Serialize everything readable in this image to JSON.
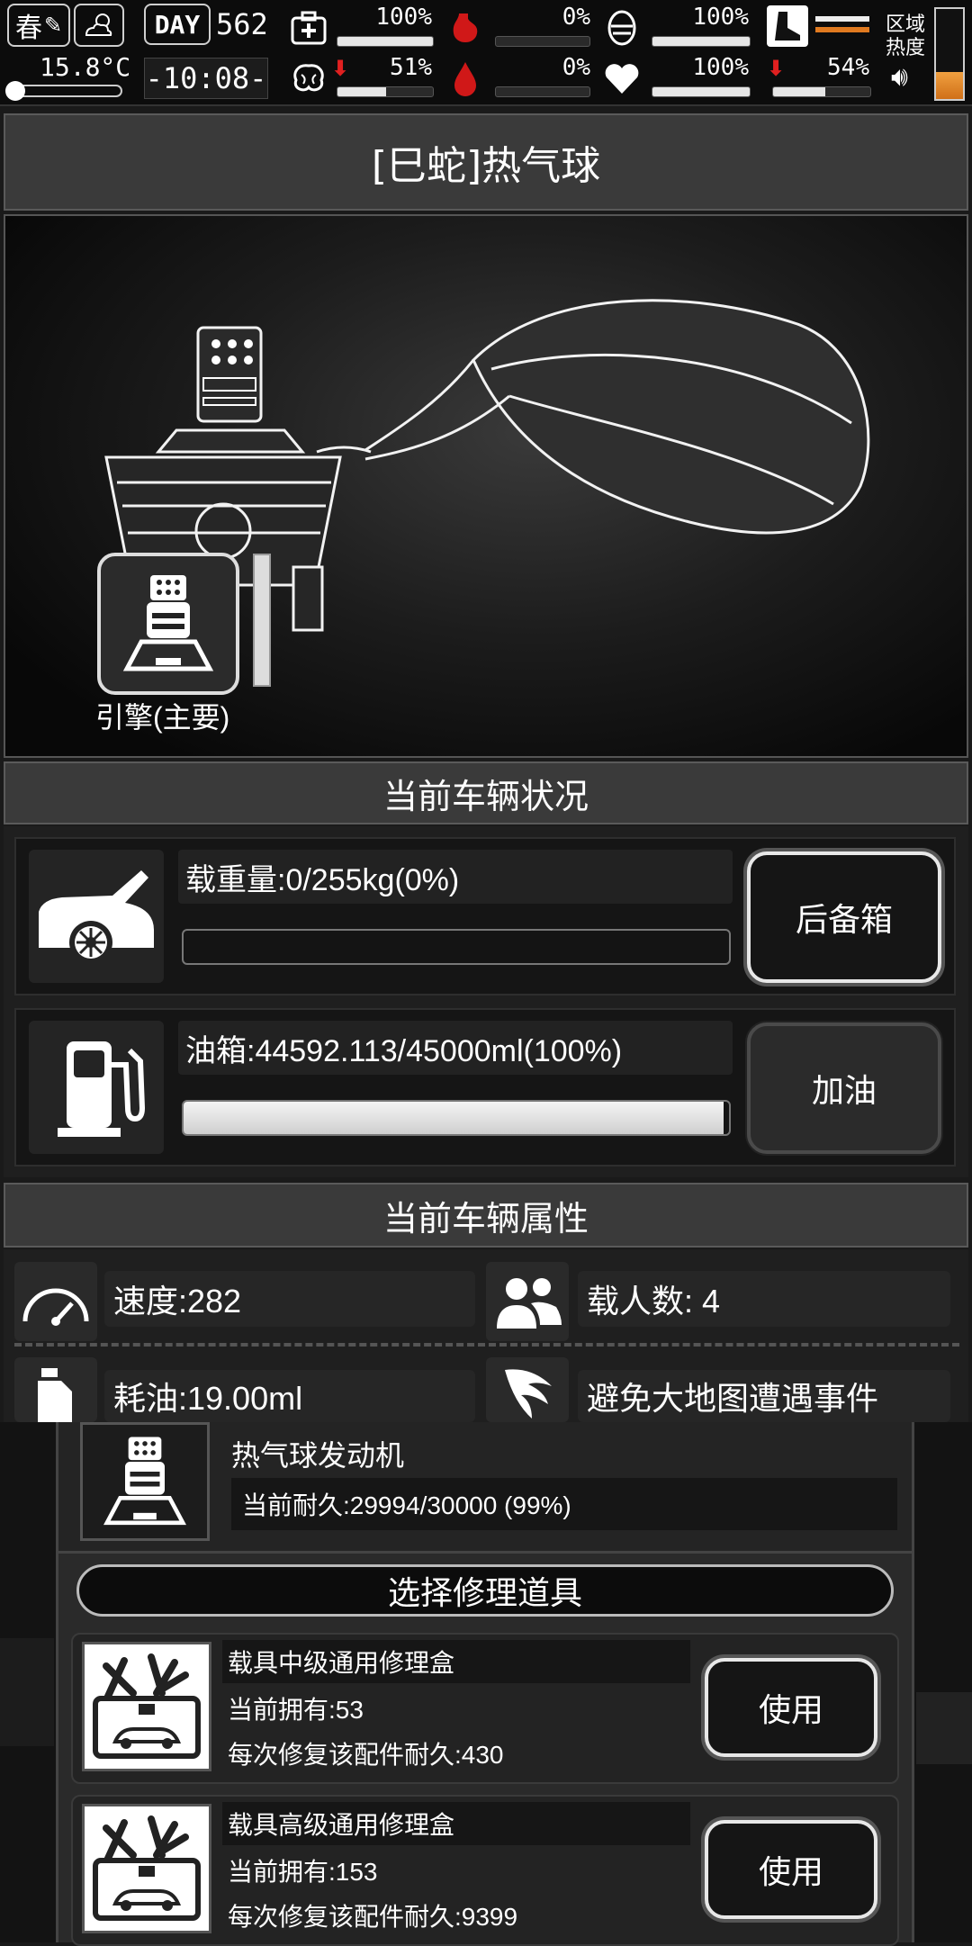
{
  "topbar": {
    "season": "春",
    "temperature": "15.8°C",
    "day_label": "DAY",
    "day_number": "562",
    "clock": "-10:08-",
    "stats": {
      "health": {
        "value": "100%",
        "fill": 1.0
      },
      "hunger": {
        "value": "0%",
        "fill": 0.0
      },
      "armor": {
        "value": "100%",
        "fill": 1.0
      },
      "mood": {
        "value": "51%",
        "fill": 0.51
      },
      "blood": {
        "value": "0%",
        "fill": 0.0
      },
      "heart": {
        "value": "100%",
        "fill": 1.0
      },
      "stamina": {
        "value": "54%",
        "fill": 0.54
      }
    },
    "zone_heat_label": "区域热度",
    "zone_heat_level": 0.3
  },
  "vehicle": {
    "title": "[巳蛇]热气球",
    "engine_label": "引擎(主要)"
  },
  "status": {
    "header": "当前车辆状况",
    "load_label": "载重量:0/255kg(0%)",
    "load_fill": 0.0,
    "trunk_button": "后备箱",
    "fuel_label": "油箱:44592.113/45000ml(100%)",
    "fuel_fill": 0.99,
    "refuel_button": "加油"
  },
  "attributes": {
    "header": "当前车辆属性",
    "speed": "速度:282",
    "passengers": "载人数:  4",
    "fuel_use": "耗油:19.00ml",
    "avoid_events": "避免大地图遭遇事件"
  },
  "repair": {
    "part_name": "热气球发动机",
    "durability": "当前耐久:29994/30000 (99%)",
    "select_header": "选择修理道具",
    "tools": [
      {
        "name": "载具中级通用修理盒",
        "owned": "当前拥有:53",
        "repair": "每次修复该配件耐久:430",
        "button": "使用"
      },
      {
        "name": "载具高级通用修理盒",
        "owned": "当前拥有:153",
        "repair": "每次修复该配件耐久:9399",
        "button": "使用"
      }
    ]
  }
}
